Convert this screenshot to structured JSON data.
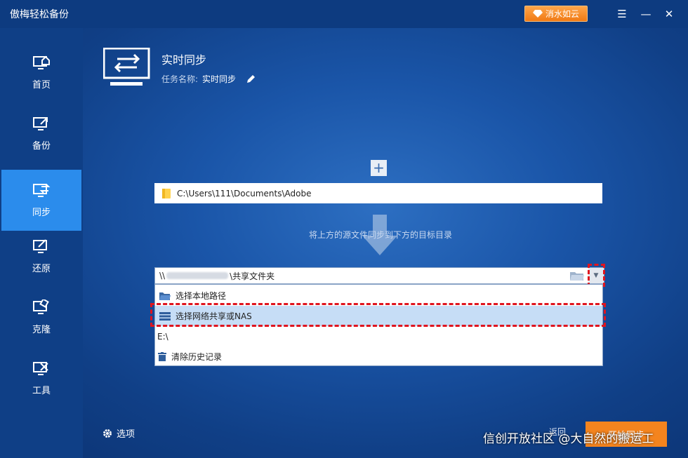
{
  "app": {
    "title": "傲梅轻松备份"
  },
  "header_buttons": {
    "upgrade": "消水如云"
  },
  "sidebar": {
    "items": [
      {
        "label": "首页",
        "icon": "home-icon"
      },
      {
        "label": "备份",
        "icon": "backup-icon"
      },
      {
        "label": "同步",
        "icon": "sync-icon",
        "active": true
      },
      {
        "label": "还原",
        "icon": "restore-icon"
      },
      {
        "label": "克隆",
        "icon": "clone-icon"
      },
      {
        "label": "工具",
        "icon": "tools-icon"
      }
    ]
  },
  "page": {
    "title": "实时同步",
    "task_label": "任务名称:",
    "task_value": "实时同步"
  },
  "source": {
    "path": "C:\\Users\\111\\Documents\\Adobe"
  },
  "hint": "将上方的源文件同步到下方的目标目录",
  "destination": {
    "prefix": "\\\\",
    "suffix": "\\共享文件夹"
  },
  "dropdown": {
    "items": [
      {
        "label": "选择本地路径",
        "icon": "folder-open-icon"
      },
      {
        "label": "选择网络共享或NAS",
        "icon": "nas-icon",
        "selected": true
      },
      {
        "label": "E:\\",
        "icon": ""
      },
      {
        "label": "清除历史记录",
        "icon": "trash-icon"
      }
    ]
  },
  "footer": {
    "options": "选项",
    "back": "返回",
    "start": "开始同步"
  },
  "watermark": "信创开放社区 @大自然的搬运工",
  "colors": {
    "accent": "#2b8cec",
    "start_button": "#f4841e",
    "highlight": "#e0151f"
  }
}
